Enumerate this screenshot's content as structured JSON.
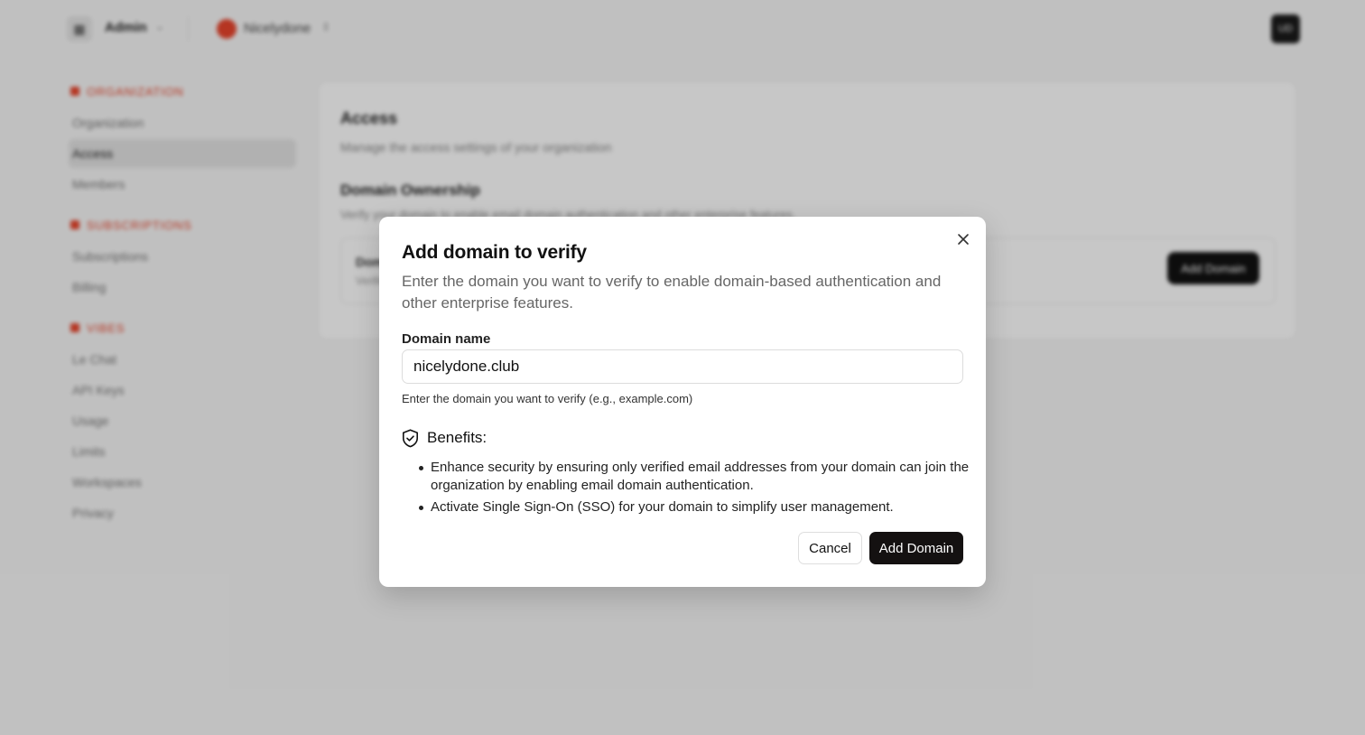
{
  "app": {
    "menu_icon": "sidebar-toggle-icon",
    "name": "Admin",
    "org_name": "Nicelydone",
    "avatar_initials": "UD"
  },
  "sidebar": {
    "sections": [
      {
        "title": "ORGANIZATION",
        "items": [
          {
            "label": "Organization",
            "active": false
          },
          {
            "label": "Access",
            "active": true
          },
          {
            "label": "Members",
            "active": false
          }
        ]
      },
      {
        "title": "SUBSCRIPTIONS",
        "items": [
          {
            "label": "Subscriptions",
            "active": false
          },
          {
            "label": "Billing",
            "active": false
          }
        ]
      },
      {
        "title": "VIBES",
        "items": [
          {
            "label": "Le Chat",
            "active": false
          },
          {
            "label": "API Keys",
            "active": false
          },
          {
            "label": "Usage",
            "active": false
          },
          {
            "label": "Limits",
            "active": false
          },
          {
            "label": "Workspaces",
            "active": false
          },
          {
            "label": "Privacy",
            "active": false
          }
        ]
      }
    ]
  },
  "page": {
    "title": "Access",
    "subtitle": "Manage the access settings of your organization",
    "section_title": "Domain Ownership",
    "section_desc": "Verify your domain to enable email domain authentication and other enterprise features.",
    "card_title": "Domains",
    "card_sub": "Verified domains",
    "add_domain_label": "Add Domain"
  },
  "modal": {
    "title": "Add domain to verify",
    "description": "Enter the domain you want to verify to enable domain-based authentication and other enterprise features.",
    "field_label": "Domain name",
    "field_value": "nicelydone.club",
    "field_help": "Enter the domain you want to verify (e.g., example.com)",
    "benefits_title": "Benefits:",
    "benefits": [
      "Enhance security by ensuring only verified email addresses from your domain can join the organization by enabling email domain authentication.",
      "Activate Single Sign-On (SSO) for your domain to simplify user management."
    ],
    "cancel_label": "Cancel",
    "submit_label": "Add Domain"
  }
}
